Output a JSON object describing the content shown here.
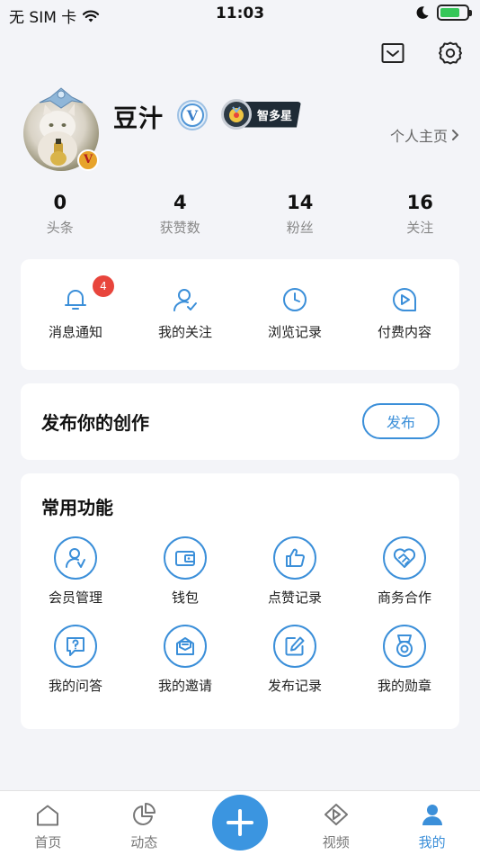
{
  "status_bar": {
    "carrier": "无 SIM 卡",
    "time": "11:03",
    "battery_level": 0.75
  },
  "profile": {
    "name": "豆汁",
    "medal_label": "智多星",
    "home_link": "个人主页",
    "vip_mark": "V"
  },
  "stats": [
    {
      "value": "0",
      "label": "头条"
    },
    {
      "value": "4",
      "label": "获赞数"
    },
    {
      "value": "14",
      "label": "粉丝"
    },
    {
      "value": "16",
      "label": "关注"
    }
  ],
  "quick": [
    {
      "label": "消息通知",
      "icon": "bell-icon",
      "badge": "4"
    },
    {
      "label": "我的关注",
      "icon": "user-check-icon"
    },
    {
      "label": "浏览记录",
      "icon": "clock-icon"
    },
    {
      "label": "付费内容",
      "icon": "play-icon"
    }
  ],
  "publish": {
    "title": "发布你的创作",
    "button": "发布"
  },
  "functions": {
    "title": "常用功能",
    "items": [
      {
        "label": "会员管理",
        "icon": "member-icon"
      },
      {
        "label": "钱包",
        "icon": "wallet-icon"
      },
      {
        "label": "点赞记录",
        "icon": "thumbs-up-icon"
      },
      {
        "label": "商务合作",
        "icon": "handshake-heart-icon"
      },
      {
        "label": "我的问答",
        "icon": "qa-icon"
      },
      {
        "label": "我的邀请",
        "icon": "invite-icon"
      },
      {
        "label": "发布记录",
        "icon": "edit-icon"
      },
      {
        "label": "我的勋章",
        "icon": "medal-icon"
      }
    ]
  },
  "tabs": [
    {
      "label": "首页",
      "icon": "home-icon"
    },
    {
      "label": "动态",
      "icon": "pie-chart-icon"
    },
    {
      "label": "视频",
      "icon": "video-icon"
    },
    {
      "label": "我的",
      "icon": "profile-icon",
      "active": true
    }
  ],
  "colors": {
    "accent": "#3b8fd9",
    "background": "#f3f4f8",
    "badge": "#e8453c"
  }
}
